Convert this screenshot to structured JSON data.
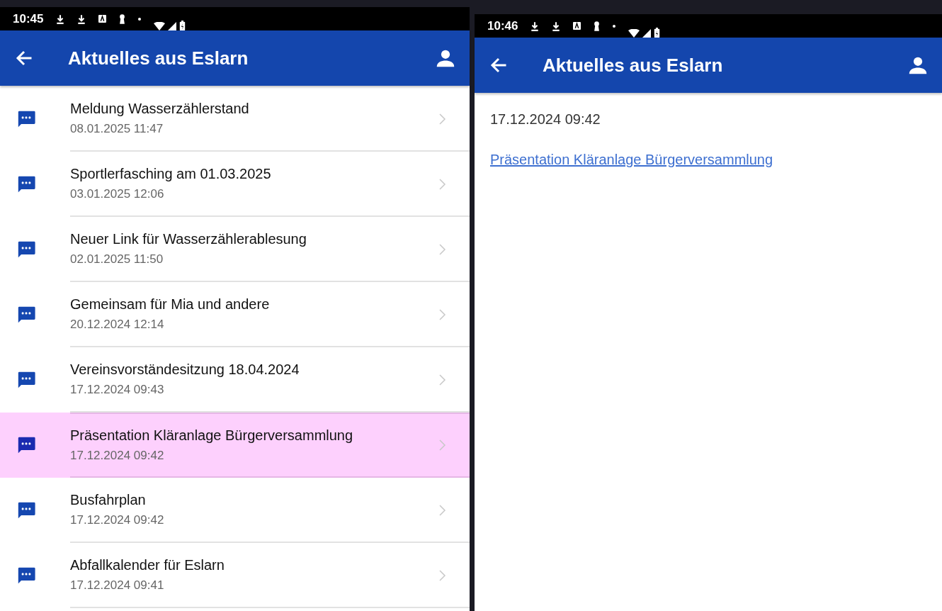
{
  "list_screen": {
    "status_bar": {
      "time": "10:45"
    },
    "app_bar": {
      "title": "Aktuelles aus Eslarn"
    },
    "items": [
      {
        "title": "Meldung Wasserzählerstand",
        "date": "08.01.2025 11:47",
        "selected": false
      },
      {
        "title": "Sportlerfasching am 01.03.2025",
        "date": "03.01.2025 12:06",
        "selected": false
      },
      {
        "title": "Neuer Link für Wasserzählerablesung",
        "date": "02.01.2025 11:50",
        "selected": false
      },
      {
        "title": "Gemeinsam für Mia und andere",
        "date": "20.12.2024 12:14",
        "selected": false
      },
      {
        "title": "Vereinsvorständesitzung 18.04.2024",
        "date": "17.12.2024 09:43",
        "selected": false
      },
      {
        "title": "Präsentation Kläranlage Bürgerversammlung",
        "date": "17.12.2024 09:42",
        "selected": true
      },
      {
        "title": "Busfahrplan",
        "date": "17.12.2024 09:42",
        "selected": false
      },
      {
        "title": "Abfallkalender für Eslarn",
        "date": "17.12.2024 09:41",
        "selected": false
      }
    ]
  },
  "detail_screen": {
    "status_bar": {
      "time": "10:46"
    },
    "app_bar": {
      "title": "Aktuelles aus Eslarn"
    },
    "date": "17.12.2024 09:42",
    "link": "Präsentation Kläranlage Bürgerversammlung"
  }
}
